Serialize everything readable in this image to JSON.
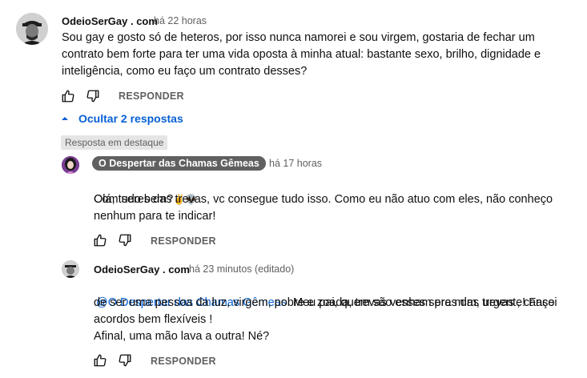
{
  "comment": {
    "author": "OdeioSerGay . com",
    "time": "há 22 horas",
    "text": "Sou gay e gosto só de heteros, por isso nunca namorei e sou virgem, gostaria de fechar um\ncontrato bem forte para ter uma vida oposta à minha atual: bastante sexo, brilho, dignidade e\ninteligência, como eu faço um contrato desses?",
    "reply_label": "RESPONDER",
    "toggle_label": "Ocultar 2 respostas"
  },
  "replies": [
    {
      "badge": "Resposta em destaque",
      "author": "O Despertar das Chamas Gêmeas",
      "time": "há 17 horas",
      "text_line1": "Olá, tudo bem?",
      "emoji": "✌️👽",
      "text_rest": "Com seres das trevas, vc consegue tudo isso. Como eu não atuo com eles, não conheço\nnenhum para te indicar!",
      "reply_label": "RESPONDER"
    },
    {
      "author": "OdeioSerGay . com",
      "time": "há 23 minutos (editado)",
      "mention": "@O Despertar das Chamas Gêmeas",
      "text_first": "  Meu pai, quem são esses seres das trevas , cansei",
      "text_rest": "de ser uma pessoa da luz, virgem, pobre e zoada, trevas venham pra mim, urgente! Faço\nacordos bem flexíveis !\nAfinal, uma mão lava a outra! Né?",
      "reply_label": "RESPONDER"
    }
  ],
  "colors": {
    "link": "#065fd4",
    "muted": "#606060",
    "text": "#0f0f0f"
  },
  "icons": [
    "thumb-up-icon",
    "thumb-down-icon",
    "chevron-up-icon"
  ]
}
